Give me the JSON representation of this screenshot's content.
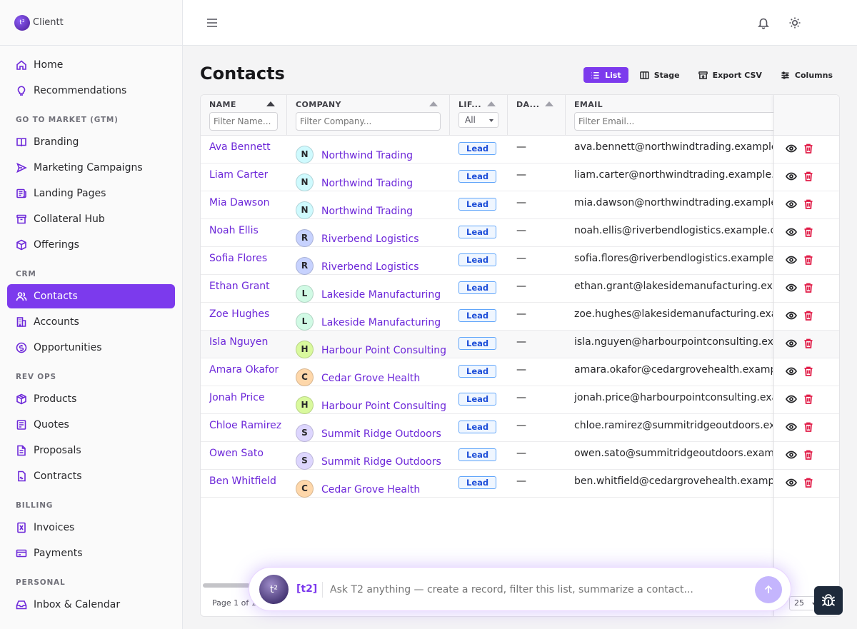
{
  "brand": {
    "name": "Clientt",
    "logo_glyph": "t²"
  },
  "sidebar": {
    "groups": [
      {
        "section": "",
        "items": [
          {
            "label": "Home",
            "icon": "home-icon"
          },
          {
            "label": "Recommendations",
            "icon": "lightbulb-icon"
          }
        ]
      },
      {
        "section": "GO TO MARKET (GTM)",
        "items": [
          {
            "label": "Branding",
            "icon": "book-icon"
          },
          {
            "label": "Marketing Campaigns",
            "icon": "send-icon"
          },
          {
            "label": "Landing Pages",
            "icon": "newspaper-icon"
          },
          {
            "label": "Collateral Hub",
            "icon": "archive-icon"
          },
          {
            "label": "Offerings",
            "icon": "package-icon"
          }
        ]
      },
      {
        "section": "CRM",
        "items": [
          {
            "label": "Contacts",
            "icon": "users-icon",
            "active": true
          },
          {
            "label": "Accounts",
            "icon": "building-icon"
          },
          {
            "label": "Opportunities",
            "icon": "dollar-icon"
          }
        ]
      },
      {
        "section": "REV OPS",
        "items": [
          {
            "label": "Products",
            "icon": "box-icon"
          },
          {
            "label": "Quotes",
            "icon": "receipt-icon"
          },
          {
            "label": "Proposals",
            "icon": "file-icon"
          },
          {
            "label": "Contracts",
            "icon": "signature-icon"
          }
        ]
      },
      {
        "section": "BILLING",
        "items": [
          {
            "label": "Invoices",
            "icon": "invoice-icon"
          },
          {
            "label": "Payments",
            "icon": "credit-card-icon"
          }
        ]
      },
      {
        "section": "PERSONAL",
        "items": [
          {
            "label": "Inbox & Calendar",
            "icon": "inbox-icon"
          }
        ]
      }
    ]
  },
  "page": {
    "title": "Contacts"
  },
  "toolbar": {
    "list_label": "List",
    "stage_label": "Stage",
    "export_label": "Export CSV",
    "columns_label": "Columns"
  },
  "table": {
    "headers": {
      "name": "NAME",
      "company": "COMPANY",
      "lifecycle": "LIF...",
      "date": "DA...",
      "email": "EMAIL"
    },
    "filters": {
      "name_placeholder": "Filter Name...",
      "company_placeholder": "Filter Company...",
      "lifecycle_value": "All",
      "email_placeholder": "Filter Email..."
    },
    "rows": [
      {
        "name": "Ava Bennett",
        "initial": "N",
        "company": "Northwind Trading",
        "lifecycle": "Lead",
        "date": "—",
        "email": "ava.bennett@northwindtrading.example.com",
        "avatar_color": "#cffafe"
      },
      {
        "name": "Liam Carter",
        "initial": "N",
        "company": "Northwind Trading",
        "lifecycle": "Lead",
        "date": "—",
        "email": "liam.carter@northwindtrading.example.com",
        "avatar_color": "#cffafe"
      },
      {
        "name": "Mia Dawson",
        "initial": "N",
        "company": "Northwind Trading",
        "lifecycle": "Lead",
        "date": "—",
        "email": "mia.dawson@northwindtrading.example.com",
        "avatar_color": "#cffafe"
      },
      {
        "name": "Noah Ellis",
        "initial": "R",
        "company": "Riverbend Logistics",
        "lifecycle": "Lead",
        "date": "—",
        "email": "noah.ellis@riverbendlogistics.example.com",
        "avatar_color": "#c7d2fe"
      },
      {
        "name": "Sofia Flores",
        "initial": "R",
        "company": "Riverbend Logistics",
        "lifecycle": "Lead",
        "date": "—",
        "email": "sofia.flores@riverbendlogistics.example.com",
        "avatar_color": "#c7d2fe"
      },
      {
        "name": "Ethan Grant",
        "initial": "L",
        "company": "Lakeside Manufacturing",
        "lifecycle": "Lead",
        "date": "—",
        "email": "ethan.grant@lakesidemanufacturing.example.com",
        "avatar_color": "#d1fae5"
      },
      {
        "name": "Zoe Hughes",
        "initial": "L",
        "company": "Lakeside Manufacturing",
        "lifecycle": "Lead",
        "date": "—",
        "email": "zoe.hughes@lakesidemanufacturing.example.com",
        "avatar_color": "#d1fae5"
      },
      {
        "name": "Isla Nguyen",
        "initial": "H",
        "company": "Harbour Point Consulting",
        "lifecycle": "Lead",
        "date": "—",
        "email": "isla.nguyen@harbourpointconsulting.example.com",
        "avatar_color": "#d9f99d",
        "highlight": true
      },
      {
        "name": "Amara Okafor",
        "initial": "C",
        "company": "Cedar Grove Health",
        "lifecycle": "Lead",
        "date": "—",
        "email": "amara.okafor@cedargrovehealth.example.com",
        "avatar_color": "#fed7aa"
      },
      {
        "name": "Jonah Price",
        "initial": "H",
        "company": "Harbour Point Consulting",
        "lifecycle": "Lead",
        "date": "—",
        "email": "jonah.price@harbourpointconsulting.example.com",
        "avatar_color": "#d9f99d"
      },
      {
        "name": "Chloe Ramirez",
        "initial": "S",
        "company": "Summit Ridge Outdoors",
        "lifecycle": "Lead",
        "date": "—",
        "email": "chloe.ramirez@summitridgeoutdoors.example.com",
        "avatar_color": "#ddd6fe"
      },
      {
        "name": "Owen Sato",
        "initial": "S",
        "company": "Summit Ridge Outdoors",
        "lifecycle": "Lead",
        "date": "—",
        "email": "owen.sato@summitridgeoutdoors.example.com",
        "avatar_color": "#ddd6fe"
      },
      {
        "name": "Ben Whitfield",
        "initial": "C",
        "company": "Cedar Grove Health",
        "lifecycle": "Lead",
        "date": "—",
        "email": "ben.whitfield@cedargrovehealth.example.com",
        "avatar_color": "#fed7aa"
      }
    ]
  },
  "pagination": {
    "text": "Page 1 of 1",
    "page_size": "25"
  },
  "assistant": {
    "logo_glyph": "t²",
    "tag": "[t2]",
    "placeholder": "Ask T2 anything — create a record, filter this list, summarize a contact..."
  },
  "colors": {
    "accent": "#7c3aed",
    "link": "#6d28d9",
    "danger": "#e11d48",
    "badge_border": "#60a5fa"
  }
}
